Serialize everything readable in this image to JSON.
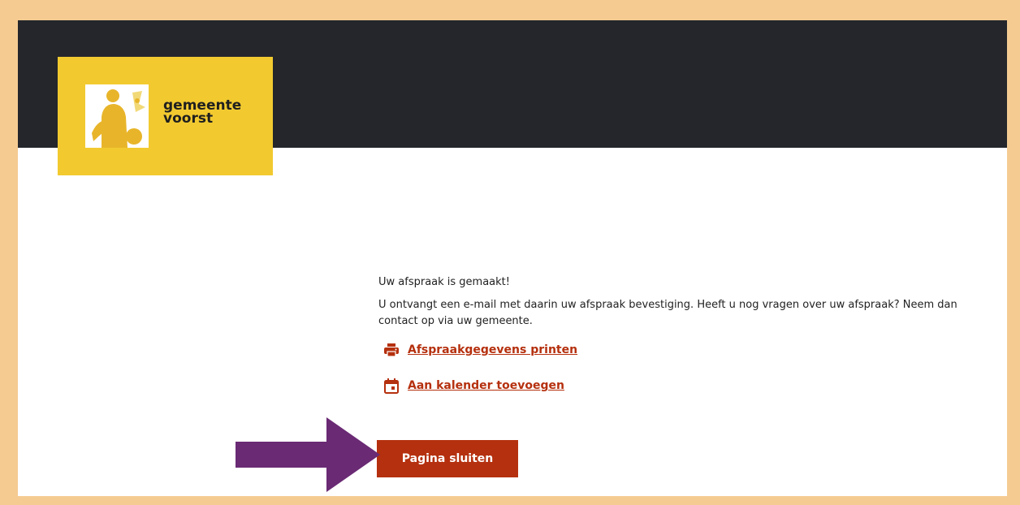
{
  "logo": {
    "line1": "gemeente",
    "line2": "voorst"
  },
  "message": {
    "title": "Uw afspraak is gemaakt!",
    "body": "U ontvangt een e-mail met daarin uw afspraak bevestiging. Heeft u nog vragen over uw afspraak? Neem dan contact op via uw gemeente."
  },
  "links": {
    "print_label": "Afspraakgegevens printen",
    "calendar_label": "Aan kalender toevoegen"
  },
  "buttons": {
    "close_label": "Pagina sluiten"
  },
  "colors": {
    "accent": "#b5300e",
    "header_bg": "#24262b",
    "logo_bg": "#f2ca30",
    "arrow": "#6a2a74",
    "border": "#f5cb92"
  },
  "icons": {
    "print": "printer-icon",
    "calendar": "calendar-icon",
    "annotation": "arrow-right-icon"
  }
}
